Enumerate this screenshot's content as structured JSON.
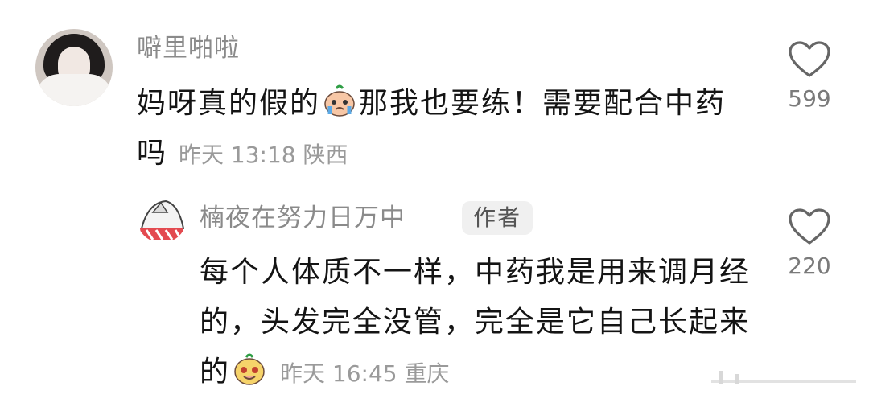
{
  "comments": [
    {
      "username": "噼里啪啦",
      "text_before_emoji": "妈呀真的假的",
      "emoji": "crying-sprout-emoji",
      "text_after_emoji": "那我也要练！需要配合中药吗",
      "time": "昨天 13:18",
      "location": "陕西",
      "likes": "599"
    },
    {
      "username": "楠夜在努力日万中",
      "badge": "作者",
      "text": "每个人体质不一样，中药我是用来调月经的，头发完全没管，完全是它自己长起来的",
      "emoji": "smiling-sprout-emoji",
      "time": "昨天 16:45",
      "location": "重庆",
      "likes": "220"
    }
  ],
  "colors": {
    "username": "#8a8a8a",
    "text": "#141414",
    "meta": "#9a9a9a",
    "badge_bg": "#f0f0f0"
  },
  "icons": {
    "like": "heart-outline-icon"
  }
}
